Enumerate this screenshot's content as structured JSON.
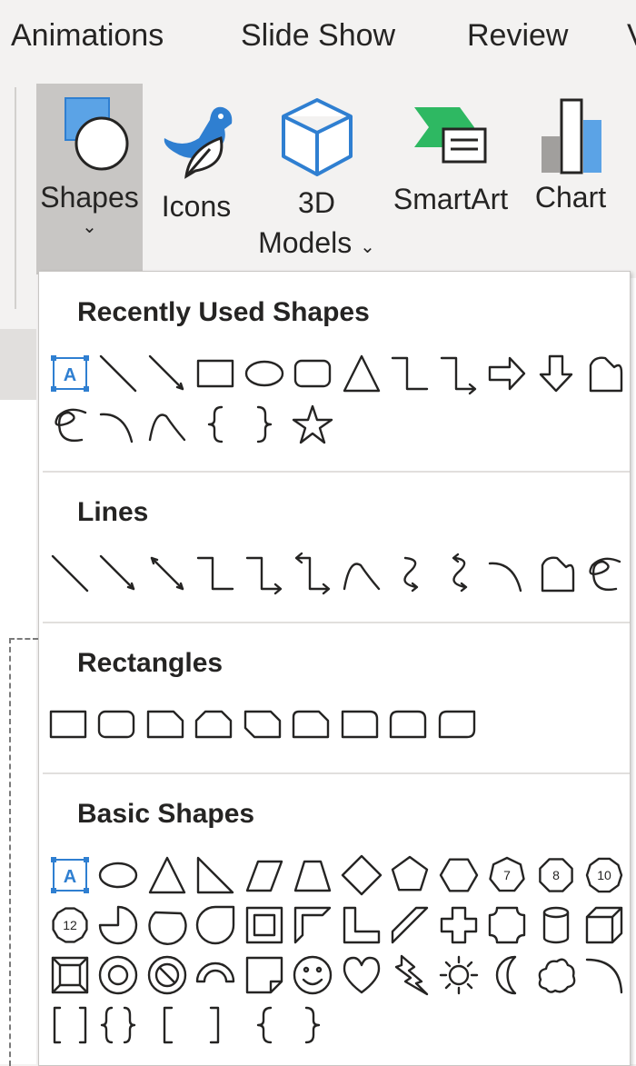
{
  "tabs": [
    "Animations",
    "Slide Show",
    "Review"
  ],
  "ribbon": {
    "shapes": "Shapes",
    "icons": "Icons",
    "models_line1": "3D",
    "models_line2": "Models",
    "smartart": "SmartArt",
    "chart": "Chart"
  },
  "colors": {
    "accent_blue": "#2f7fd1",
    "pressed_button": "#c8c6c4"
  },
  "gallery": {
    "sections": [
      {
        "title": "Recently Used Shapes",
        "rows": [
          [
            "text-box",
            "line",
            "arrow-line",
            "rectangle",
            "oval",
            "rounded-rectangle",
            "triangle",
            "elbow-connector",
            "elbow-arrow-connector",
            "right-arrow",
            "down-arrow",
            "freeform"
          ],
          [
            "scribble",
            "curve",
            "curved-connector",
            "left-brace",
            "right-brace",
            "star-5-point"
          ]
        ]
      },
      {
        "title": "Lines",
        "rows": [
          [
            "line",
            "arrow-line",
            "double-arrow-line",
            "elbow-connector",
            "elbow-arrow-connector",
            "elbow-double-arrow",
            "curved-connector",
            "curved-arrow-connector",
            "curved-double-arrow",
            "curve",
            "freeform",
            "scribble"
          ]
        ]
      },
      {
        "title": "Rectangles",
        "rows": [
          [
            "rectangle",
            "rounded-rectangle",
            "snip-single-corner",
            "snip-same-side",
            "snip-diagonal",
            "snip-round-corner",
            "round-single-corner",
            "round-same-side",
            "round-diagonal"
          ]
        ]
      },
      {
        "title": "Basic Shapes",
        "rows": [
          [
            "text-box",
            "oval",
            "triangle",
            "right-triangle",
            "parallelogram",
            "trapezoid",
            "diamond",
            "pentagon",
            "hexagon",
            "heptagon",
            "octagon",
            "decagon"
          ],
          [
            "dodecagon",
            "pie",
            "chord",
            "teardrop",
            "frame",
            "half-frame",
            "l-shape",
            "diagonal-stripe",
            "cross",
            "plaque",
            "can",
            "cube"
          ],
          [
            "bevel",
            "donut",
            "no-symbol",
            "block-arc",
            "folded-corner",
            "smiley-face",
            "heart",
            "lightning-bolt",
            "sun",
            "moon",
            "cloud",
            "arc"
          ],
          [
            "double-bracket",
            "double-brace",
            "left-bracket",
            "right-bracket",
            "left-brace",
            "right-brace"
          ]
        ]
      }
    ],
    "polygon_numbers": {
      "heptagon": "7",
      "octagon": "8",
      "decagon": "10",
      "dodecagon": "12"
    }
  }
}
